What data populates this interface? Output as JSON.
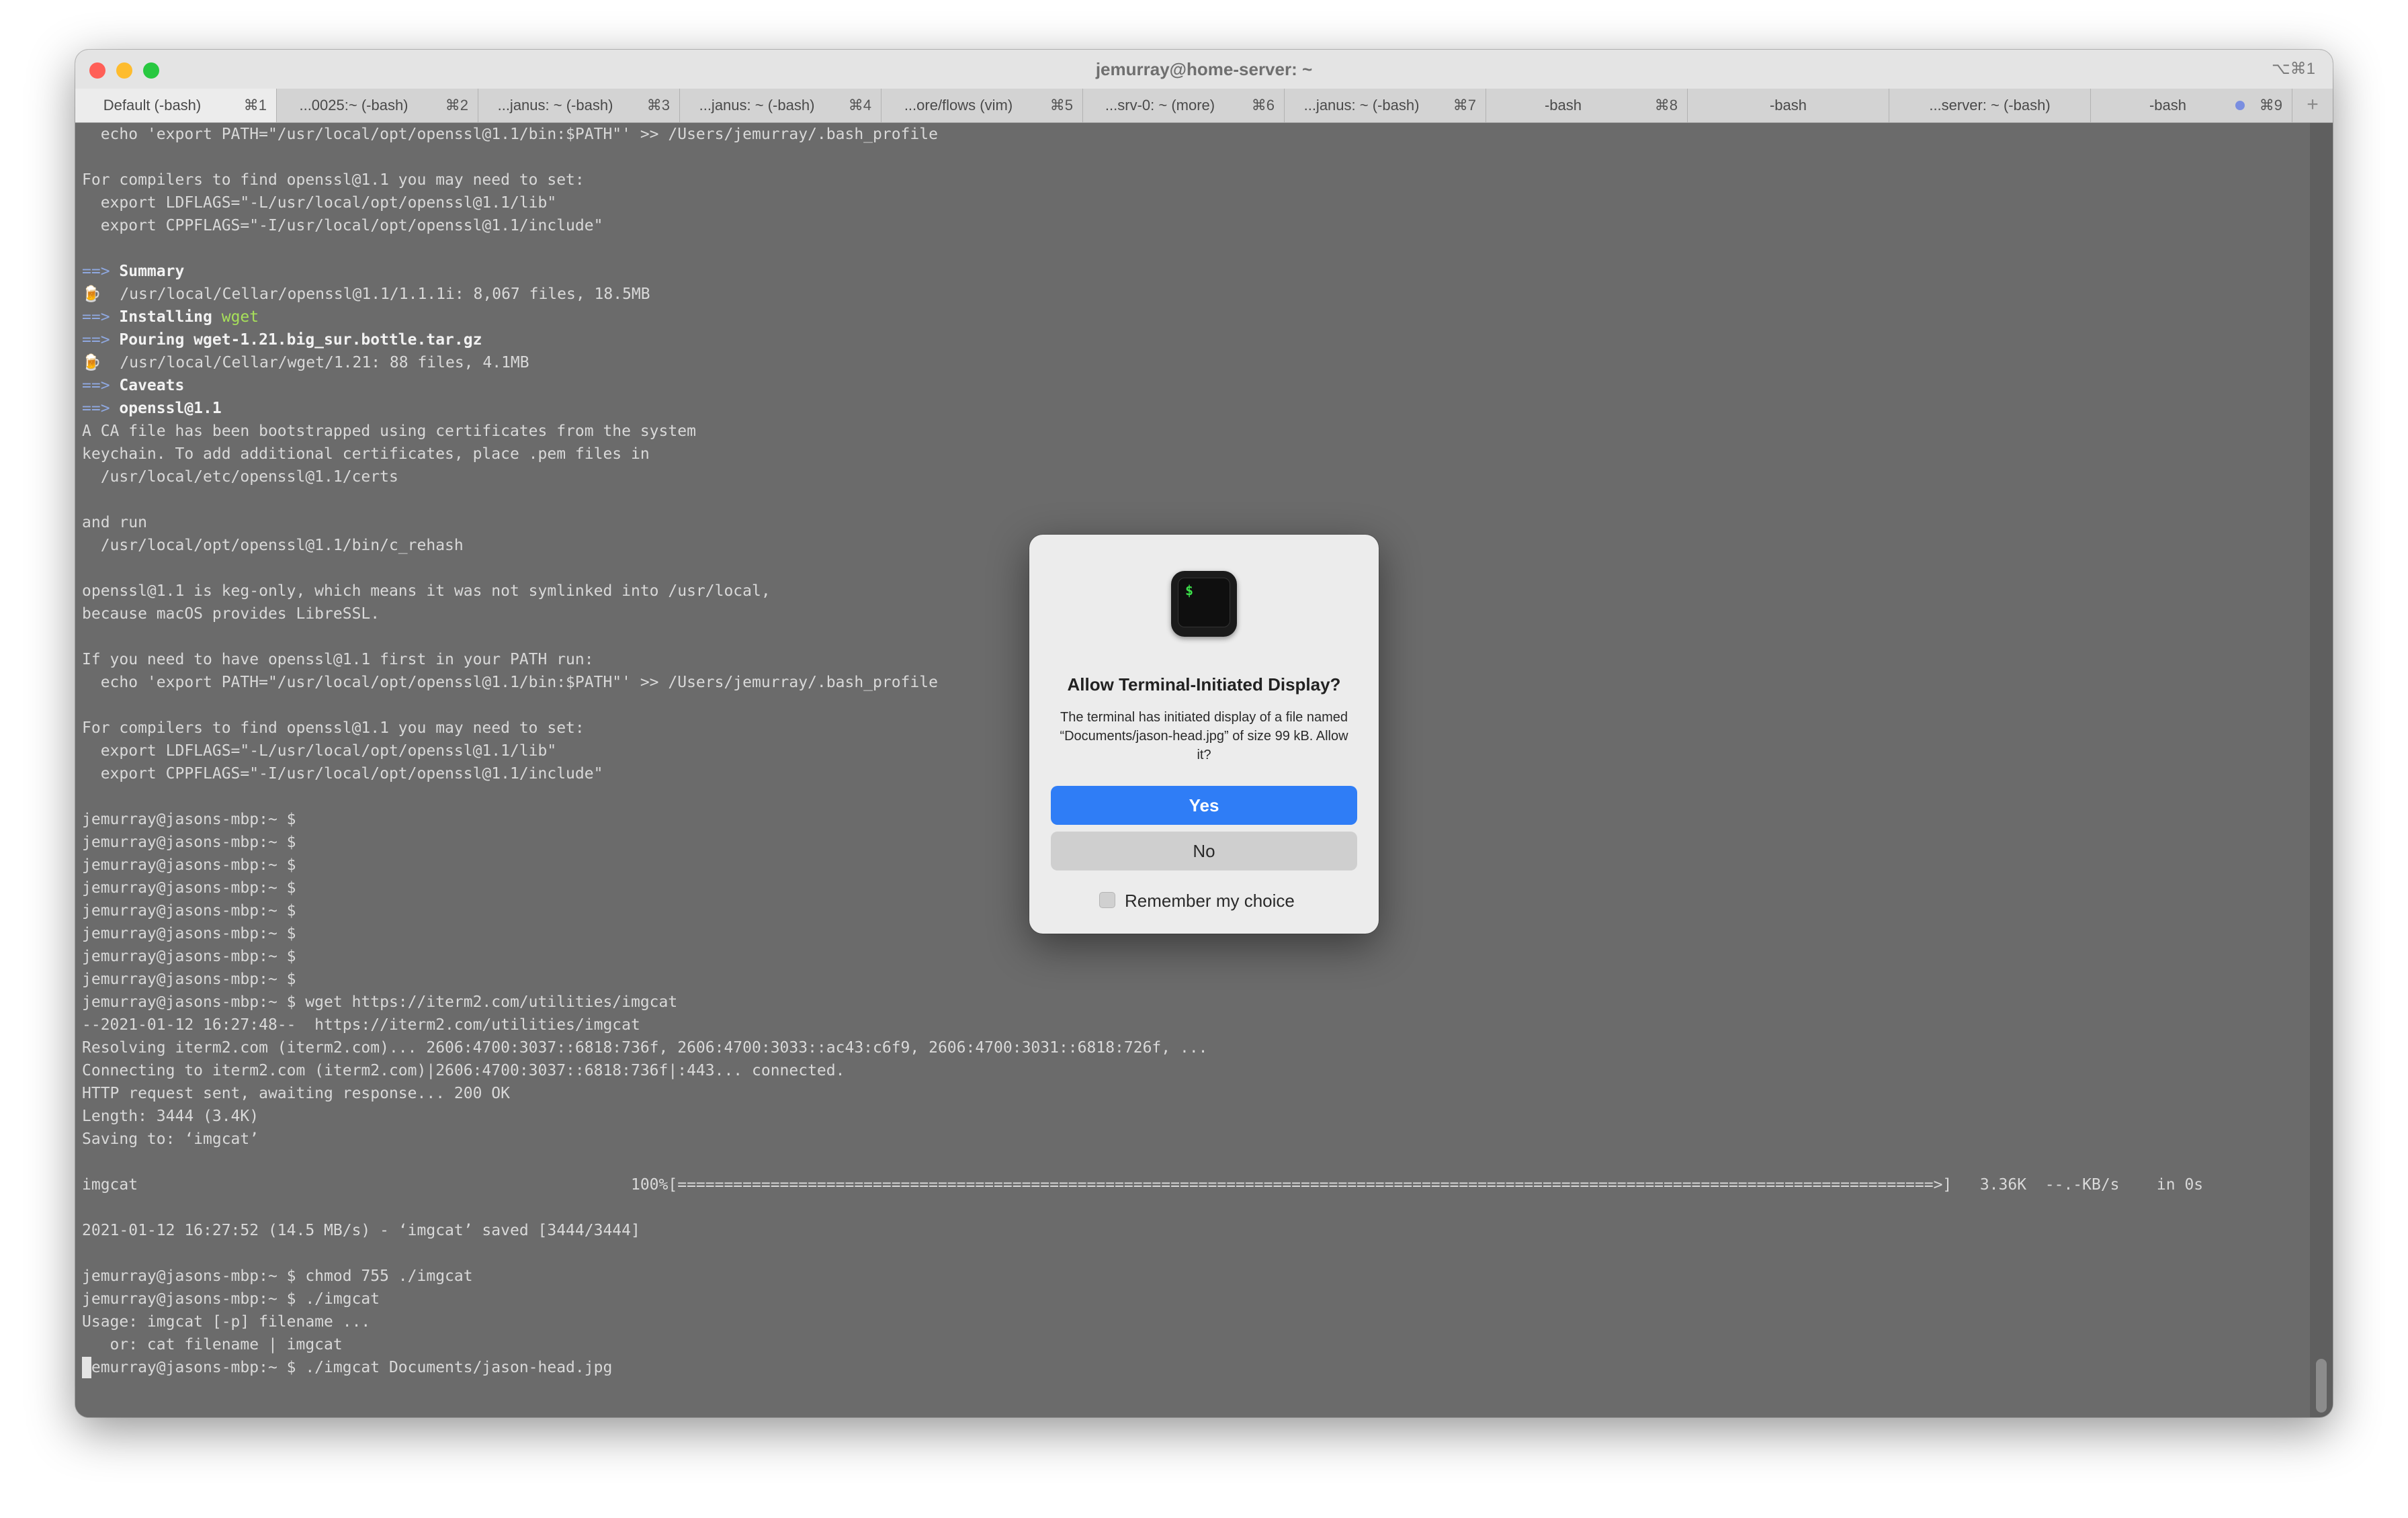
{
  "window": {
    "title": "jemurray@home-server: ~",
    "shortcut": "⌥⌘1"
  },
  "tabs": [
    {
      "label": "Default (-bash)",
      "key": "⌘1",
      "active": true
    },
    {
      "label": "...0025:~ (-bash)",
      "key": "⌘2",
      "active": false
    },
    {
      "label": "...janus: ~ (-bash)",
      "key": "⌘3",
      "active": false
    },
    {
      "label": "...janus: ~ (-bash)",
      "key": "⌘4",
      "active": false
    },
    {
      "label": "...ore/flows (vim)",
      "key": "⌘5",
      "active": false
    },
    {
      "label": "...srv-0: ~ (more)",
      "key": "⌘6",
      "active": false
    },
    {
      "label": "...janus: ~ (-bash)",
      "key": "⌘7",
      "active": false
    },
    {
      "label": "-bash",
      "key": "⌘8",
      "active": false
    },
    {
      "label": "-bash",
      "key": "",
      "active": false
    },
    {
      "label": "...server: ~ (-bash)",
      "key": "",
      "active": false
    },
    {
      "label": "-bash",
      "key": "⌘9",
      "active": false
    }
  ],
  "new_tab_label": "+",
  "terminal": {
    "lines": [
      "  echo 'export PATH=\"/usr/local/opt/openssl@1.1/bin:$PATH\"' >> /Users/jemurray/.bash_profile",
      "",
      "For compilers to find openssl@1.1 you may need to set:",
      "  export LDFLAGS=\"-L/usr/local/opt/openssl@1.1/lib\"",
      "  export CPPFLAGS=\"-I/usr/local/opt/openssl@1.1/include\"",
      "",
      "==> Summary",
      "🍺  /usr/local/Cellar/openssl@1.1/1.1.1i: 8,067 files, 18.5MB",
      "==> Installing wget",
      "==> Pouring wget-1.21.big_sur.bottle.tar.gz",
      "🍺  /usr/local/Cellar/wget/1.21: 88 files, 4.1MB",
      "==> Caveats",
      "==> openssl@1.1",
      "A CA file has been bootstrapped using certificates from the system",
      "keychain. To add additional certificates, place .pem files in",
      "  /usr/local/etc/openssl@1.1/certs",
      "",
      "and run",
      "  /usr/local/opt/openssl@1.1/bin/c_rehash",
      "",
      "openssl@1.1 is keg-only, which means it was not symlinked into /usr/local,",
      "because macOS provides LibreSSL.",
      "",
      "If you need to have openssl@1.1 first in your PATH run:",
      "  echo 'export PATH=\"/usr/local/opt/openssl@1.1/bin:$PATH\"' >> /Users/jemurray/.bash_profile",
      "",
      "For compilers to find openssl@1.1 you may need to set:",
      "  export LDFLAGS=\"-L/usr/local/opt/openssl@1.1/lib\"",
      "  export CPPFLAGS=\"-I/usr/local/opt/openssl@1.1/include\"",
      "",
      "jemurray@jasons-mbp:~ $",
      "jemurray@jasons-mbp:~ $",
      "jemurray@jasons-mbp:~ $",
      "jemurray@jasons-mbp:~ $",
      "jemurray@jasons-mbp:~ $",
      "jemurray@jasons-mbp:~ $",
      "jemurray@jasons-mbp:~ $",
      "jemurray@jasons-mbp:~ $",
      "jemurray@jasons-mbp:~ $ wget https://iterm2.com/utilities/imgcat",
      "--2021-01-12 16:27:48--  https://iterm2.com/utilities/imgcat",
      "Resolving iterm2.com (iterm2.com)... 2606:4700:3037::6818:736f, 2606:4700:3033::ac43:c6f9, 2606:4700:3031::6818:726f, ...",
      "Connecting to iterm2.com (iterm2.com)|2606:4700:3037::6818:736f|:443... connected.",
      "HTTP request sent, awaiting response... 200 OK",
      "Length: 3444 (3.4K)",
      "Saving to: ‘imgcat’",
      "",
      "imgcat                                                     100%[=======================================================================================================================================>]   3.36K  --.-KB/s    in 0s",
      "",
      "2021-01-12 16:27:52 (14.5 MB/s) - ‘imgcat’ saved [3444/3444]",
      "",
      "jemurray@jasons-mbp:~ $ chmod 755 ./imgcat",
      "jemurray@jasons-mbp:~ $ ./imgcat",
      "Usage: imgcat [-p] filename ...",
      "   or: cat filename | imgcat",
      "jemurray@jasons-mbp:~ $ ./imgcat Documents/jason-head.jpg"
    ]
  },
  "dialog": {
    "icon": "terminal-app-icon",
    "icon_prompt": "$",
    "title": "Allow Terminal-Initiated Display?",
    "message": "The terminal has initiated display of a file named “Documents/jason-head.jpg” of size 99 kB. Allow it?",
    "yes_label": "Yes",
    "no_label": "No",
    "remember_label": "Remember my choice",
    "remember_checked": false,
    "primary_color": "#2f7df6"
  }
}
